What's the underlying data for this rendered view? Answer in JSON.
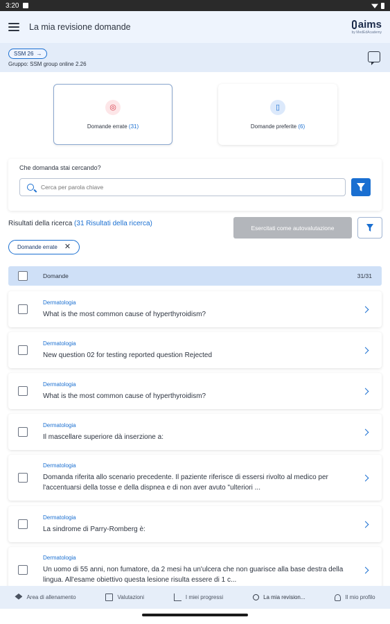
{
  "status_bar": {
    "time": "3:20"
  },
  "topbar": {
    "title": "La mia revisione domande",
    "logo": "aims",
    "logo_sub": "by MedEdAcademy"
  },
  "subheader": {
    "chip": "SSM 26",
    "group": "Gruppo: SSM group online 2.26"
  },
  "cards": [
    {
      "label": "Domande errate",
      "count": "(31)",
      "icon": "target-icon"
    },
    {
      "label": "Domande preferite",
      "count": "(6)",
      "icon": "bookmark-icon"
    }
  ],
  "search": {
    "label": "Che domanda stai cercando?",
    "placeholder": "Cerca per parola chiave"
  },
  "results": {
    "title": "Risultati della ricerca",
    "count": "(31 Risultati della ricerca)",
    "self_eval_button": "Esercitati come autovalutazione"
  },
  "filter_chip": {
    "label": "Domande errate"
  },
  "list_header": {
    "label": "Domande",
    "count": "31/31"
  },
  "questions": [
    {
      "category": "Dermatologia",
      "text": "What is the most common cause of hyperthyroidism?"
    },
    {
      "category": "Dermatologia",
      "text": "New question 02 for testing reported question Rejected"
    },
    {
      "category": "Dermatologia",
      "text": "What is the most common cause of hyperthyroidism?"
    },
    {
      "category": "Dermatologia",
      "text": "Il mascellare superiore dà inserzione a:"
    },
    {
      "category": "Dermatologia",
      "text": "Domanda riferita allo scenario precedente. Il paziente riferisce di essersi rivolto al medico per l'accentuarsi della tosse e della dispnea e di non aver avuto \"ulteriori ..."
    },
    {
      "category": "Dermatologia",
      "text": "La sindrome di Parry-Romberg è:"
    },
    {
      "category": "Dermatologia",
      "text": "Un uomo di 55 anni, non fumatore, da 2 mesi ha un'ulcera che non guarisce alla base destra della lingua. All'esame obiettivo questa lesione risulta essere di 1 c..."
    }
  ],
  "bottom_nav": [
    {
      "label": "Area di allenamento",
      "icon": "graduation-cap-icon"
    },
    {
      "label": "Valutazioni",
      "icon": "book-icon"
    },
    {
      "label": "I miei progressi",
      "icon": "chart-icon"
    },
    {
      "label": "La mia revision...",
      "icon": "search-icon"
    },
    {
      "label": "Il mio profilo",
      "icon": "user-icon"
    }
  ]
}
